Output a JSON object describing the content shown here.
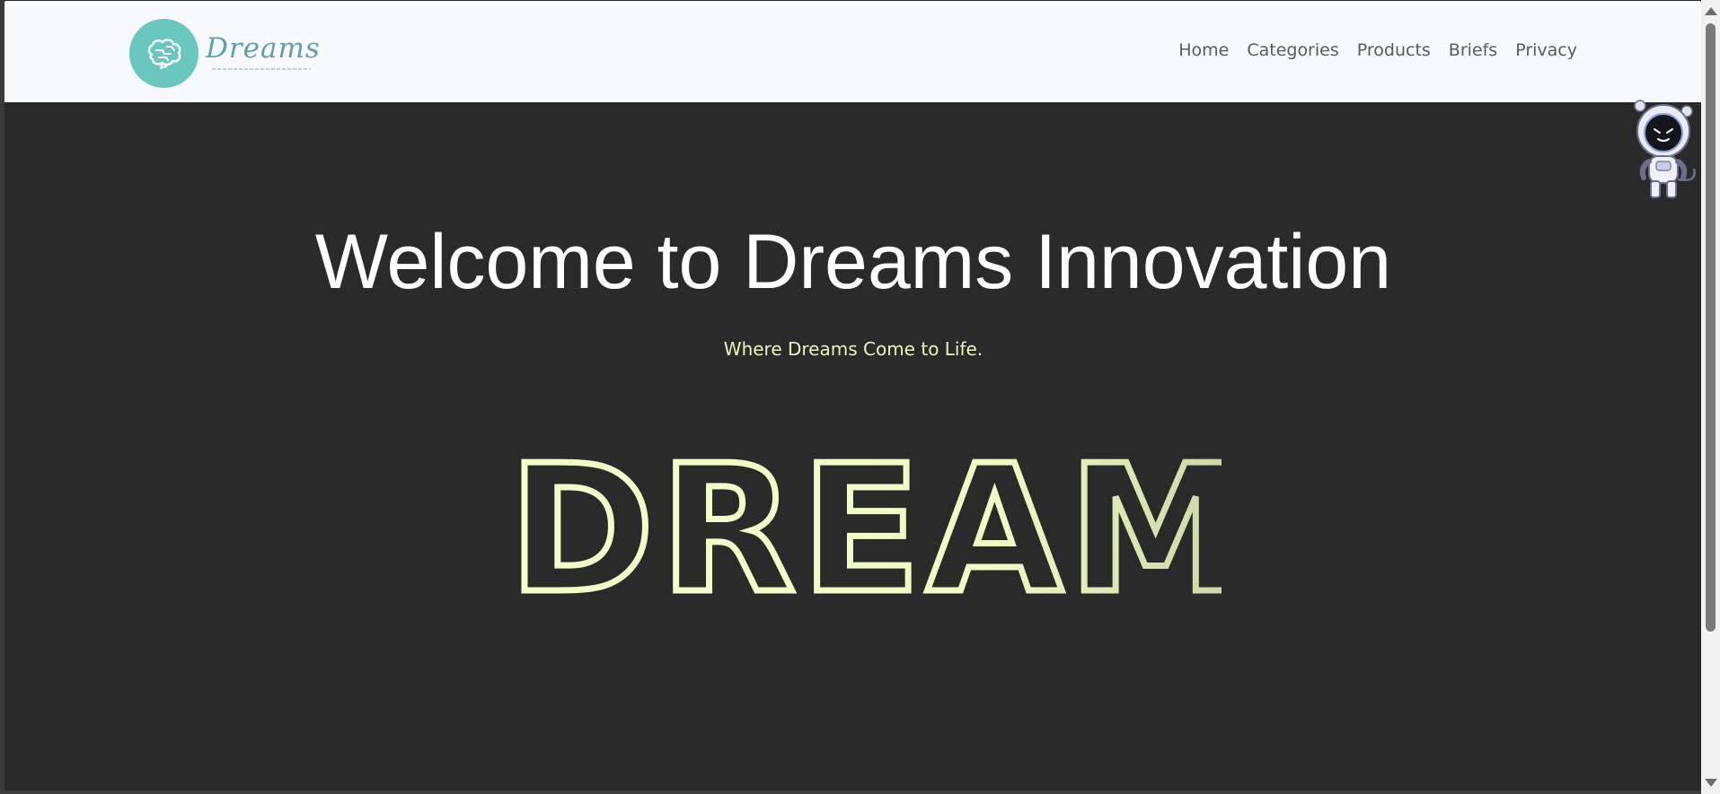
{
  "brand": {
    "name": "Dreams",
    "logo_icon": "brain-icon",
    "colors": {
      "logo_circle": "#6ac7c0",
      "logo_text": "#5fa0a8"
    }
  },
  "nav": {
    "items": [
      {
        "label": "Home"
      },
      {
        "label": "Categories"
      },
      {
        "label": "Products"
      },
      {
        "label": "Briefs"
      },
      {
        "label": "Privacy"
      }
    ]
  },
  "hero": {
    "title": "Welcome to Dreams Innovation",
    "subtitle": "Where Dreams Come to Life.",
    "outline_word": "DREAMS",
    "colors": {
      "background": "#2a2a2a",
      "title": "#ffffff",
      "subtitle": "#e8f5b8",
      "outline": "#f3ffc9",
      "outline_dim": "#6f7069"
    }
  },
  "mascot": {
    "icon": "astronaut-mascot-icon"
  }
}
